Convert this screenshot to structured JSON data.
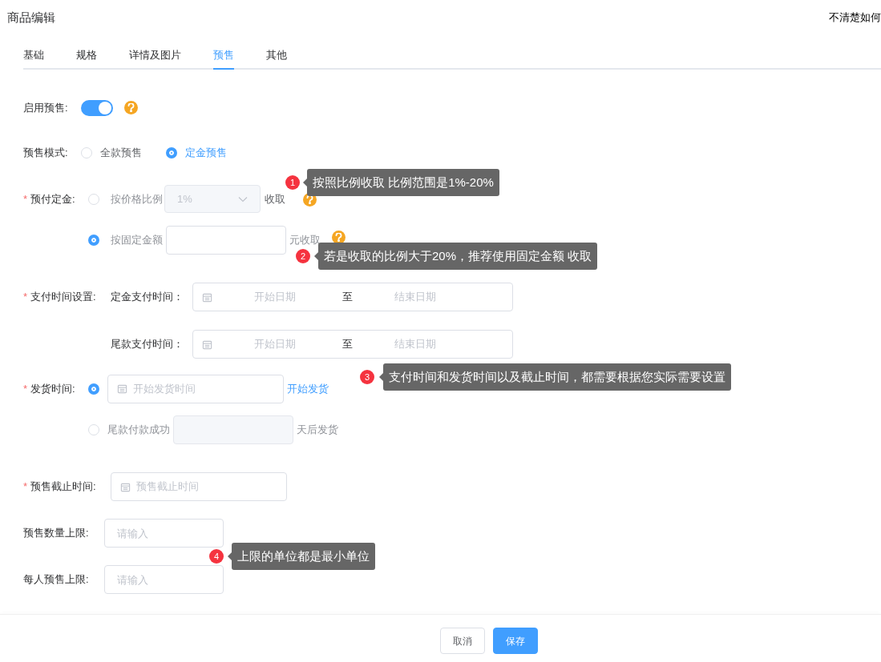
{
  "page_title": "商品编辑",
  "help_link": "不清楚如何",
  "tabs": [
    {
      "label": "基础",
      "selected": false
    },
    {
      "label": "规格",
      "selected": false
    },
    {
      "label": "详情及图片",
      "selected": false
    },
    {
      "label": "预售",
      "selected": true
    },
    {
      "label": "其他",
      "selected": false
    }
  ],
  "enable_presale": {
    "label": "启用预售:",
    "on": true
  },
  "mode": {
    "label": "预售模式:",
    "options": [
      {
        "label": "全款预售",
        "selected": false
      },
      {
        "label": "定金预售",
        "selected": true
      }
    ]
  },
  "deposit": {
    "label": "预付定金:",
    "required_mark": "*",
    "options": [
      {
        "kind": "ratio",
        "label": "按价格比例",
        "selected": false,
        "value": "1%",
        "suffix": "收取"
      },
      {
        "kind": "fixed",
        "label": "按固定金额",
        "selected": true,
        "suffix": "元收取"
      }
    ]
  },
  "payment_time": {
    "label": "支付时间设置:",
    "required_mark": "*",
    "ranges": [
      {
        "label": "定金支付时间：",
        "start": "开始日期",
        "separator": "至",
        "end": "结束日期"
      },
      {
        "label": "尾款支付时间：",
        "start": "开始日期",
        "separator": "至",
        "end": "结束日期"
      }
    ]
  },
  "shipping": {
    "label": "发货时间:",
    "required_mark": "*",
    "options": [
      {
        "kind": "date",
        "selected": true,
        "placeholder": "开始发货时间",
        "suffix": "开始发货"
      },
      {
        "kind": "days",
        "selected": false,
        "label": "尾款付款成功",
        "suffix": "天后发货"
      }
    ]
  },
  "deadline": {
    "label": "预售截止时间:",
    "required_mark": "*",
    "placeholder": "预售截止时间"
  },
  "limits": [
    {
      "label": "预售数量上限:",
      "placeholder": "请输入"
    },
    {
      "label": "每人预售上限:",
      "placeholder": "请输入"
    }
  ],
  "annotations": [
    {
      "number": "1",
      "text": "按照比例收取 比例范围是1%-20%"
    },
    {
      "number": "2",
      "text": "若是收取的比例大于20%，推荐使用固定金额 收取"
    },
    {
      "number": "3",
      "text": "支付时间和发货时间以及截止时间，都需要根据您实际需要设置"
    },
    {
      "number": "4",
      "text": "上限的单位都是最小单位"
    }
  ],
  "buttons": [
    {
      "label": "取消",
      "kind": "secondary"
    },
    {
      "label": "保存",
      "kind": "primary"
    }
  ]
}
